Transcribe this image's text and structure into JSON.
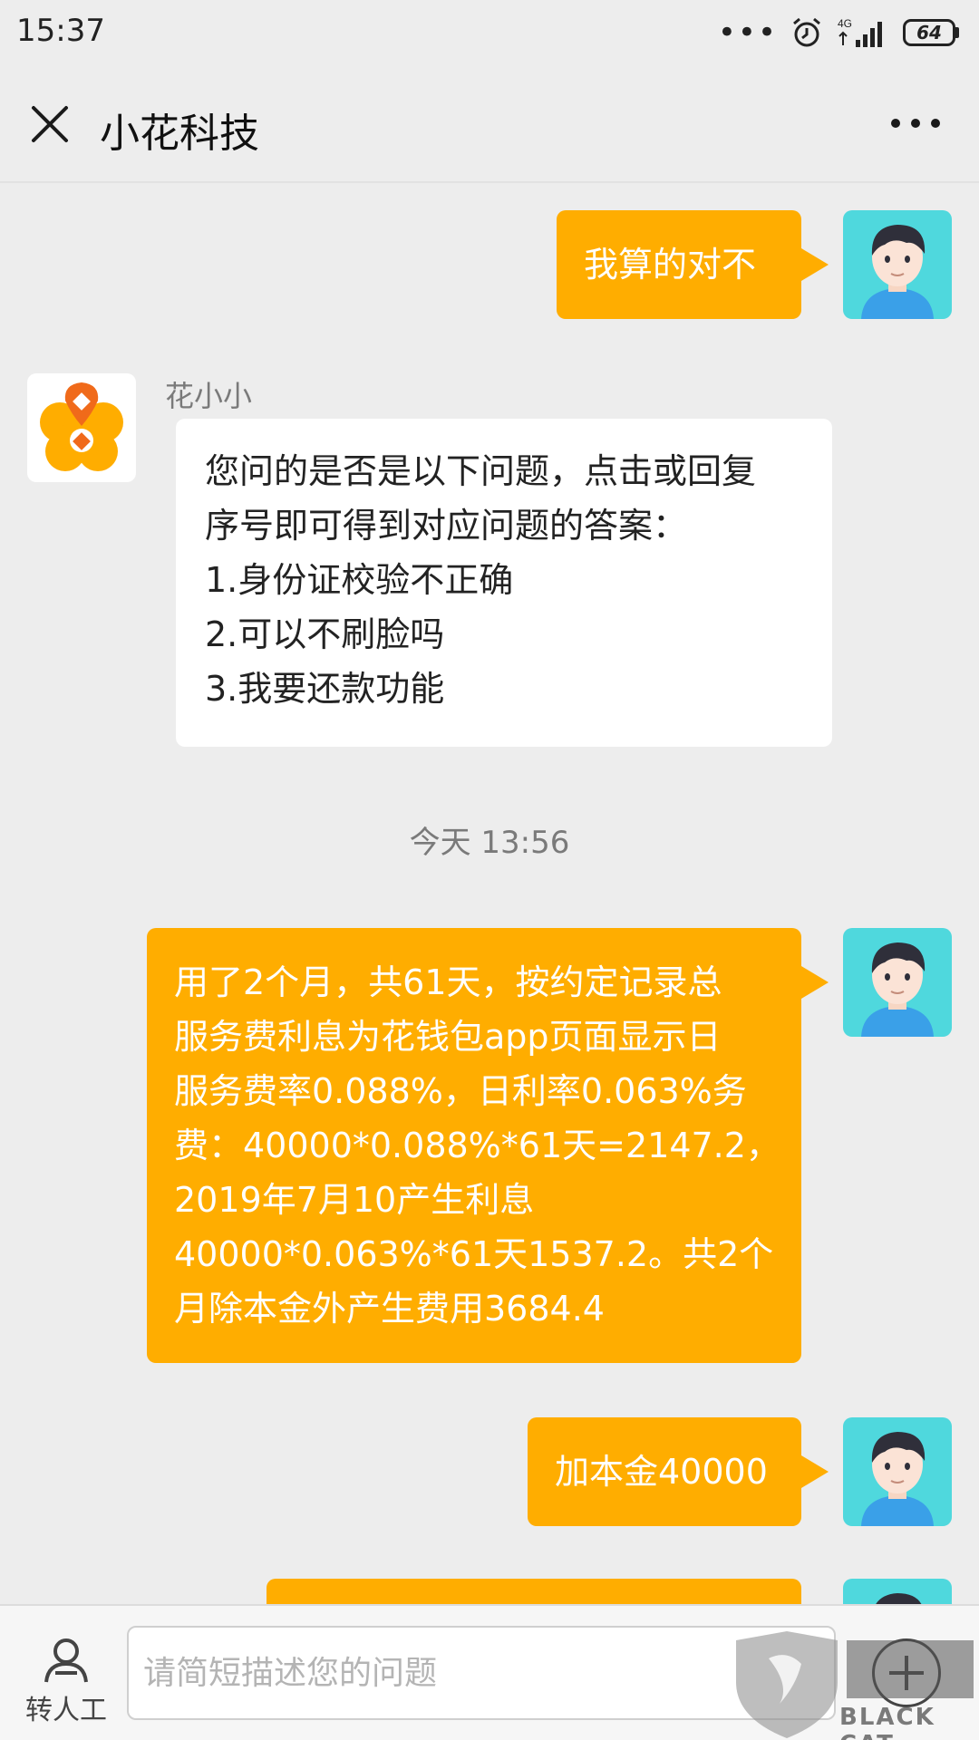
{
  "status_bar": {
    "time": "15:37",
    "network": "4G",
    "battery": "64"
  },
  "nav": {
    "title": "小花科技"
  },
  "messages": [
    {
      "side": "out",
      "lines": [
        "我算的对不"
      ]
    },
    {
      "side": "in",
      "sender": "花小小",
      "lines": [
        "您问的是否是以下问题，点击或回复",
        "序号即可得到对应问题的答案：",
        "1.身份证校验不正确",
        "2.可以不刷脸吗",
        "3.我要还款功能"
      ]
    },
    {
      "type": "time",
      "text": "今天 13:56"
    },
    {
      "side": "out",
      "lines": [
        "用了2个月，共61天，按约定记录总",
        "服务费利息为花钱包app页面显示日",
        "服务费率0.088%，日利率0.063%务",
        "费：40000*0.088%*61天=2147.2，",
        "2019年7月10产生利息",
        "40000*0.063%*61天1537.2。共2个",
        "月除本金外产生费用3684.4"
      ]
    },
    {
      "side": "out",
      "lines": [
        "加本金40000"
      ]
    }
  ],
  "input_bar": {
    "transfer_label": "转人工",
    "placeholder": "请简短描述您的问题"
  },
  "watermark": {
    "text": "BLACK CAT"
  },
  "colors": {
    "outgoing_bubble": "#ffad00",
    "user_avatar": "#4fd8dd",
    "bot_logo": "#ffad00",
    "bot_logo_accent": "#f06a1a"
  }
}
